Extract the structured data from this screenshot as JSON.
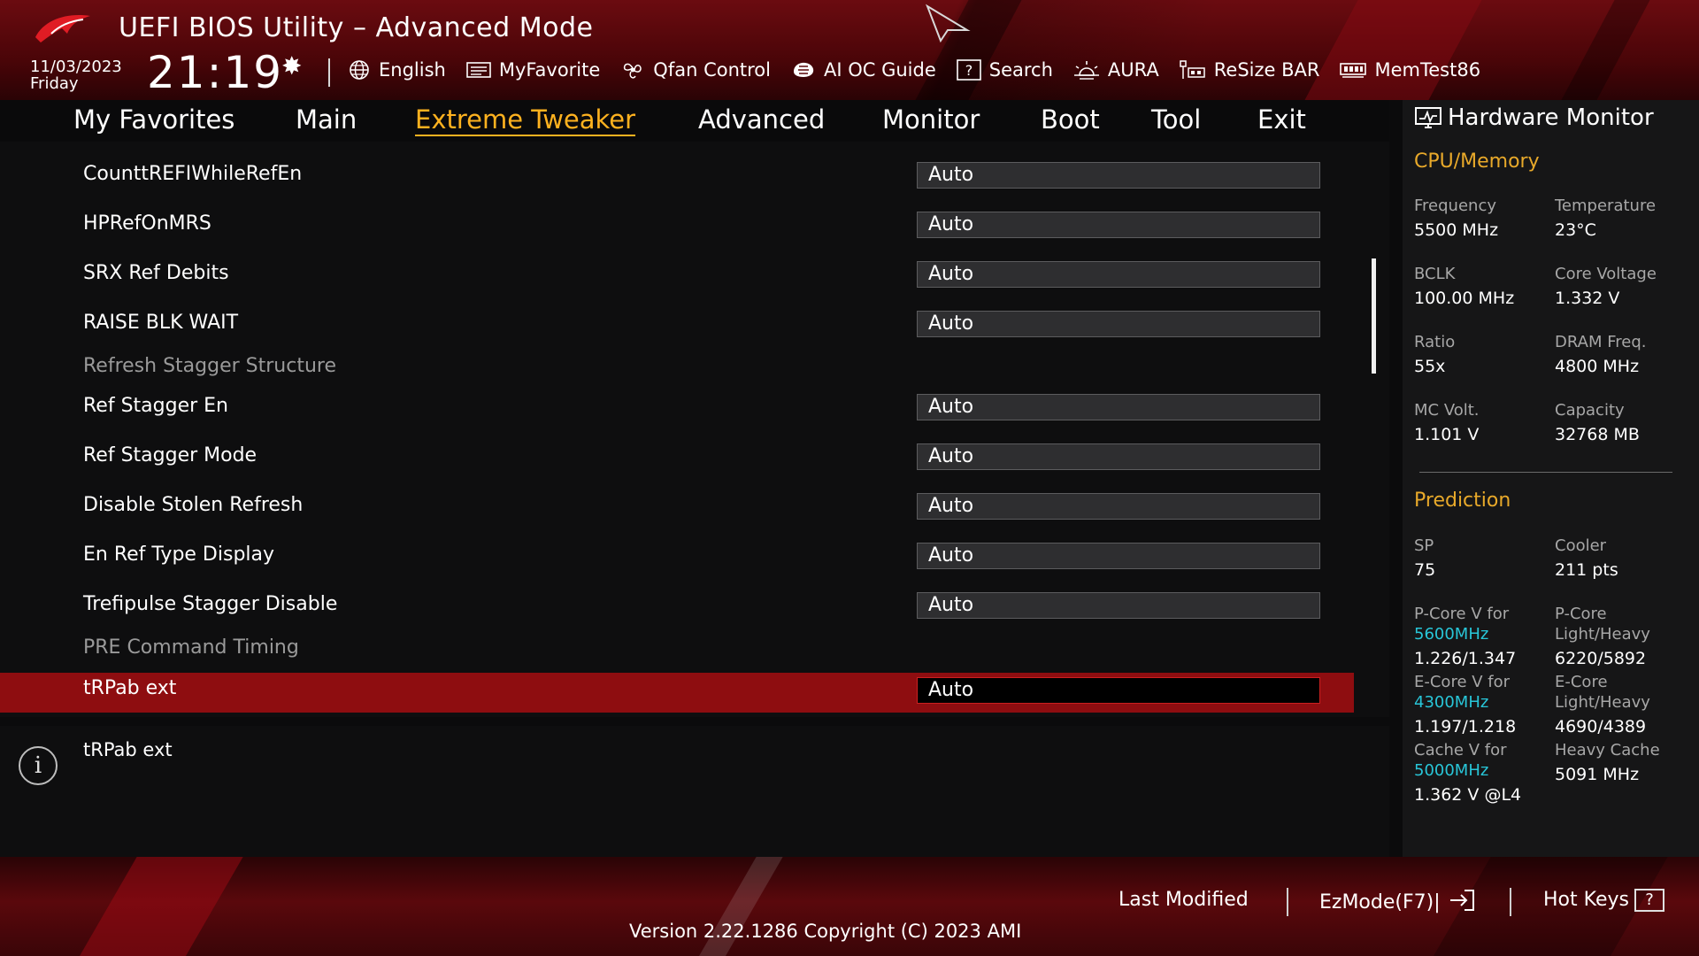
{
  "header": {
    "title": "UEFI BIOS Utility – Advanced Mode",
    "date": "11/03/2023",
    "weekday": "Friday",
    "time": "21:19",
    "tools": [
      {
        "label": "English",
        "icon": "globe-icon"
      },
      {
        "label": "MyFavorite",
        "icon": "favorite-icon"
      },
      {
        "label": "Qfan Control",
        "icon": "fan-icon"
      },
      {
        "label": "AI OC Guide",
        "icon": "ai-chip-icon"
      },
      {
        "label": "Search",
        "icon": "search-icon"
      },
      {
        "label": "AURA",
        "icon": "aura-icon"
      },
      {
        "label": "ReSize BAR",
        "icon": "resize-bar-icon"
      },
      {
        "label": "MemTest86",
        "icon": "memory-icon"
      }
    ]
  },
  "tabs": [
    "My Favorites",
    "Main",
    "Extreme Tweaker",
    "Advanced",
    "Monitor",
    "Boot",
    "Tool",
    "Exit"
  ],
  "active_tab": "Extreme Tweaker",
  "settings": [
    {
      "label": "CounttREFIWhileRefEn",
      "value": "Auto"
    },
    {
      "label": "HPRefOnMRS",
      "value": "Auto"
    },
    {
      "label": "SRX Ref Debits",
      "value": "Auto"
    },
    {
      "label": "RAISE BLK WAIT",
      "value": "Auto"
    },
    {
      "label": "Refresh Stagger Structure",
      "value": null
    },
    {
      "label": "Ref Stagger En",
      "value": "Auto"
    },
    {
      "label": "Ref Stagger Mode",
      "value": "Auto"
    },
    {
      "label": "Disable Stolen Refresh",
      "value": "Auto"
    },
    {
      "label": "En Ref Type Display",
      "value": "Auto"
    },
    {
      "label": "Trefipulse Stagger Disable",
      "value": "Auto"
    },
    {
      "label": "PRE Command Timing",
      "value": null
    },
    {
      "label": "tRPab ext",
      "value": "Auto"
    }
  ],
  "info": {
    "text": "tRPab ext"
  },
  "hardware_monitor": {
    "title": "Hardware Monitor",
    "cpu_memory": {
      "heading": "CPU/Memory",
      "frequency_label": "Frequency",
      "frequency": "5500 MHz",
      "temperature_label": "Temperature",
      "temperature": "23°C",
      "bclk_label": "BCLK",
      "bclk": "100.00 MHz",
      "core_voltage_label": "Core Voltage",
      "core_voltage": "1.332 V",
      "ratio_label": "Ratio",
      "ratio": "55x",
      "dram_freq_label": "DRAM Freq.",
      "dram_freq": "4800 MHz",
      "mc_volt_label": "MC Volt.",
      "mc_volt": "1.101 V",
      "capacity_label": "Capacity",
      "capacity": "32768 MB"
    },
    "prediction": {
      "heading": "Prediction",
      "sp_label": "SP",
      "sp": "75",
      "cooler_label": "Cooler",
      "cooler": "211 pts",
      "pcore_v_label": "P-Core V for",
      "pcore_v_freq": "5600MHz",
      "pcore_v": "1.226/1.347",
      "pcore_lh_label": "P-Core Light/Heavy",
      "pcore_lh": "6220/5892",
      "ecore_v_label": "E-Core V for",
      "ecore_v_freq": "4300MHz",
      "ecore_v": "1.197/1.218",
      "ecore_lh_label": "E-Core Light/Heavy",
      "ecore_lh": "4690/4389",
      "cache_v_label": "Cache V for",
      "cache_v_freq": "5000MHz",
      "cache_v": "1.362 V @L4",
      "heavy_cache_label": "Heavy Cache",
      "heavy_cache": "5091 MHz"
    }
  },
  "footer": {
    "last_modified": "Last Modified",
    "ezmode": "EzMode(F7)|",
    "hotkeys": "Hot Keys",
    "hotkeys_key": "?",
    "version": "Version 2.22.1286 Copyright (C) 2023 AMI"
  },
  "colors": {
    "accent_orange": "#ffb21f",
    "selection_red": "#8e0d10",
    "highlight_cyan": "#28c6d8"
  }
}
